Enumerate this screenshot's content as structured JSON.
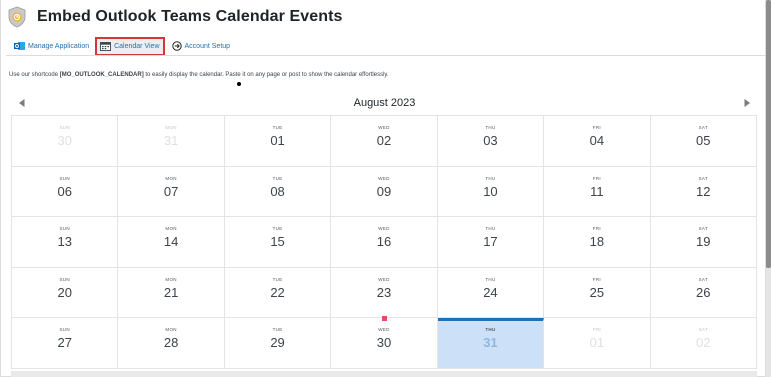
{
  "app": {
    "title": "Embed Outlook Teams Calendar Events"
  },
  "tabs": [
    {
      "label": "Manage Application",
      "icon": "outlook-icon",
      "active": false
    },
    {
      "label": "Calendar View",
      "icon": "calendar-icon",
      "active": true
    },
    {
      "label": "Account Setup",
      "icon": "arrow-circle-icon",
      "active": false
    }
  ],
  "info": {
    "prefix": "Use our shortcode ",
    "shortcode": "[MO_OUTLOOK_CALENDAR]",
    "suffix": " to easily display the calendar. Paste it on any page or post to show the calendar effortlessly."
  },
  "calendar": {
    "month_label": "August 2023",
    "prev_icon": "chevron-left-icon",
    "next_icon": "chevron-right-icon",
    "colors": {
      "accent": "#2271b1",
      "today_bg": "#cce0f7",
      "event": "#e6496b",
      "active_tab_border": "#d63638"
    },
    "weeks": [
      [
        {
          "dow": "SUN",
          "day": "30",
          "muted": true
        },
        {
          "dow": "MON",
          "day": "31",
          "muted": true
        },
        {
          "dow": "TUE",
          "day": "01"
        },
        {
          "dow": "WED",
          "day": "02"
        },
        {
          "dow": "THU",
          "day": "03"
        },
        {
          "dow": "FRI",
          "day": "04"
        },
        {
          "dow": "SAT",
          "day": "05"
        }
      ],
      [
        {
          "dow": "SUN",
          "day": "06"
        },
        {
          "dow": "MON",
          "day": "07"
        },
        {
          "dow": "TUE",
          "day": "08"
        },
        {
          "dow": "WED",
          "day": "09"
        },
        {
          "dow": "THU",
          "day": "10"
        },
        {
          "dow": "FRI",
          "day": "11"
        },
        {
          "dow": "SAT",
          "day": "12"
        }
      ],
      [
        {
          "dow": "SUN",
          "day": "13"
        },
        {
          "dow": "MON",
          "day": "14"
        },
        {
          "dow": "TUE",
          "day": "15"
        },
        {
          "dow": "WED",
          "day": "16"
        },
        {
          "dow": "THU",
          "day": "17"
        },
        {
          "dow": "FRI",
          "day": "18"
        },
        {
          "dow": "SAT",
          "day": "19"
        }
      ],
      [
        {
          "dow": "SUN",
          "day": "20"
        },
        {
          "dow": "MON",
          "day": "21"
        },
        {
          "dow": "TUE",
          "day": "22"
        },
        {
          "dow": "WED",
          "day": "23",
          "event": true
        },
        {
          "dow": "THU",
          "day": "24"
        },
        {
          "dow": "FRI",
          "day": "25"
        },
        {
          "dow": "SAT",
          "day": "26"
        }
      ],
      [
        {
          "dow": "SUN",
          "day": "27"
        },
        {
          "dow": "MON",
          "day": "28"
        },
        {
          "dow": "TUE",
          "day": "29"
        },
        {
          "dow": "WED",
          "day": "30"
        },
        {
          "dow": "THU",
          "day": "31",
          "today": true
        },
        {
          "dow": "FRI",
          "day": "01",
          "muted": true
        },
        {
          "dow": "SAT",
          "day": "02",
          "muted": true
        }
      ]
    ]
  }
}
